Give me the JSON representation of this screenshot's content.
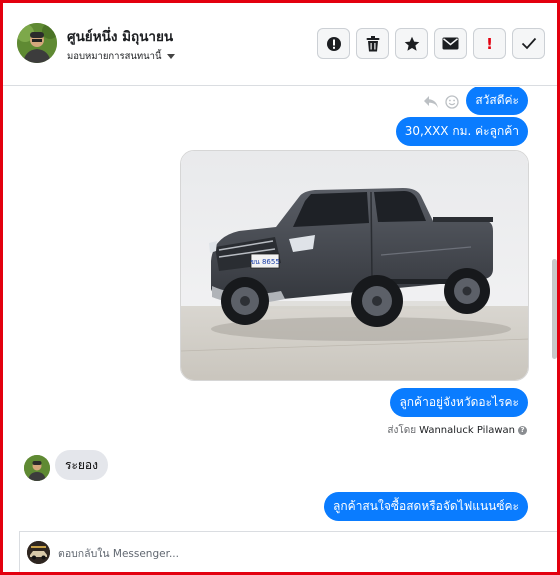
{
  "header": {
    "contact_name": "ศูนย์หนึ่ง มิถุนายน",
    "assign_label": "มอบหมายการสนทนานี้",
    "actions": [
      {
        "icon": "alert-circle-icon"
      },
      {
        "icon": "trash-icon"
      },
      {
        "icon": "star-icon"
      },
      {
        "icon": "envelope-icon"
      },
      {
        "icon": "exclamation-icon",
        "label": "!"
      },
      {
        "icon": "checkmark-icon"
      }
    ]
  },
  "messages": [
    {
      "from": "page",
      "text": "สวัสดีค่ะ"
    },
    {
      "from": "page",
      "text": "30,XXX  กม. ค่ะลูกค้า"
    },
    {
      "from": "page",
      "type": "image",
      "image_text": "ขน 8655"
    },
    {
      "from": "page",
      "text": "ลูกค้าอยู่จังหวัดอะไรคะ"
    },
    {
      "from": "customer",
      "text": "ระยอง"
    },
    {
      "from": "page",
      "text": "ลูกค้าสนใจซื้อสดหรือจัดไฟแนนซ์คะ"
    }
  ],
  "sent_by": {
    "prefix": "ส่งโดย",
    "name": "Wannaluck Pilawan",
    "info": "?"
  },
  "reply": {
    "placeholder": "ตอบกลับใน Messenger..."
  },
  "colors": {
    "accent": "#0a7cff",
    "frame": "#e3000f",
    "incoming_bubble": "#e4e6eb",
    "alert": "#e3000f"
  }
}
